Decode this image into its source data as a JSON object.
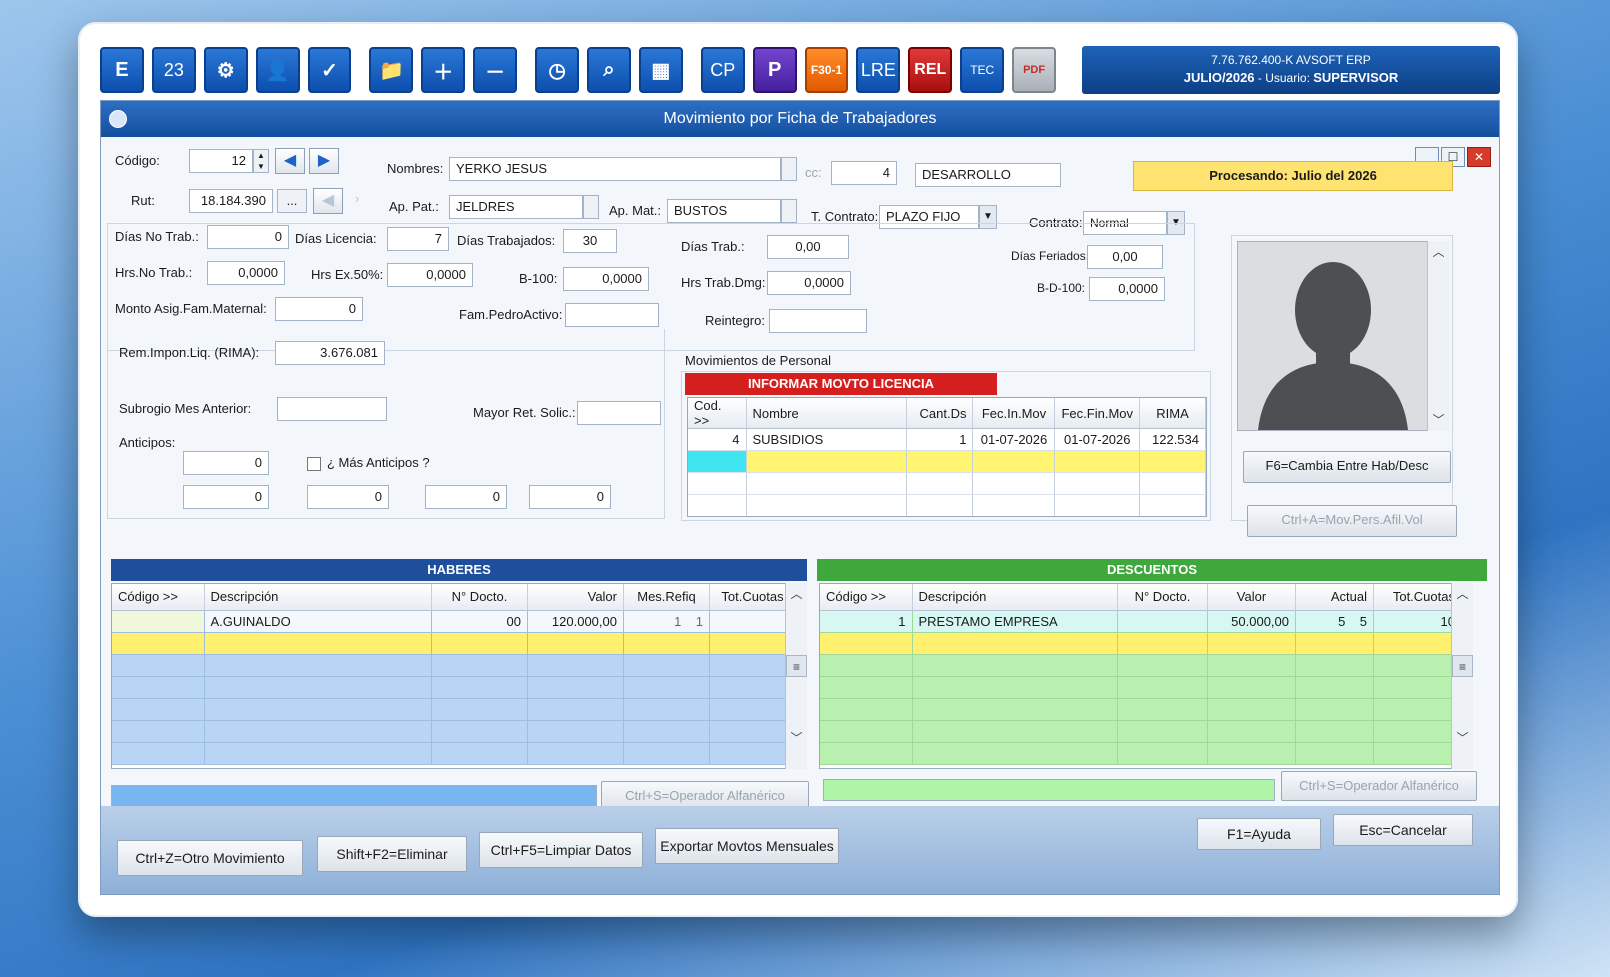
{
  "toolbar": {
    "icons": [
      "E",
      "23",
      "⚙",
      "👤",
      "✓",
      "📁",
      "＋",
      "－",
      "◷",
      "⌕",
      "▦",
      "CP",
      "P",
      "F30-1",
      "LRE",
      "REL",
      "TEC",
      "PDF"
    ]
  },
  "brand": {
    "line1": "7.76.762.400-K AVSOFT ERP",
    "period": "JULIO/2026",
    "user_label": "- Usuario:",
    "user": "SUPERVISOR"
  },
  "window": {
    "title": "Movimiento por Ficha de Trabajadores"
  },
  "form": {
    "codigo_label": "Código:",
    "codigo": "12",
    "rut_label": "Rut:",
    "rut": "18.184.390",
    "rut_btn": "...",
    "nombres_label": "Nombres:",
    "nombres": "YERKO JESUS",
    "cc_label": "cc:",
    "cc_num": "4",
    "cc_name": "DESARROLLO",
    "ap_pat_label": "Ap. Pat.:",
    "ap_pat": "JELDRES",
    "ap_mat_label": "Ap. Mat.:",
    "ap_mat": "BUSTOS",
    "t_contrato_label": "T. Contrato:",
    "t_contrato": "PLAZO FIJO",
    "contrato_label": "Contrato:",
    "contrato": "Normal",
    "procesando": "Procesando: Julio del 2026",
    "dias_no_trab_label": "Días No Trab.:",
    "dias_no_trab": "0",
    "dias_licencia_label": "Días Licencia:",
    "dias_licencia": "7",
    "dias_trabajados_label": "Días Trabajados:",
    "dias_trabajados": "30",
    "dias_trab_label": "Días Trab.:",
    "dias_trab": "0,00",
    "dias_feriados_label": "Días Feriados:",
    "dias_feriados": "0,00",
    "hrs_no_trab_label": "Hrs.No Trab.:",
    "hrs_no_trab": "0,0000",
    "hrs_ex_label": "Hrs Ex.50%:",
    "hrs_ex": "0,0000",
    "b100_label": "B-100:",
    "b100": "0,0000",
    "hrs_trab_dmg_label": "Hrs Trab.Dmg:",
    "hrs_trab_dmg": "0,0000",
    "bd100_label": "B-D-100:",
    "bd100": "0,0000",
    "monto_asig_label": "Monto Asig.Fam.Maternal:",
    "monto_asig": "0",
    "fam_pedro_label": "Fam.PedroActivo:",
    "fam_pedro": "",
    "reintegro_label": "Reintegro:",
    "reintegro": "",
    "rem_impon_label": "Rem.Impon.Liq. (RIMA):",
    "rem_impon": "3.676.081",
    "subrogio_label": "Subrogio Mes Anterior:",
    "subrogio": "",
    "mayor_ret_label": "Mayor Ret. Solic.:",
    "mayor_ret": "",
    "anticipos_label": "Anticipos:",
    "anticipo_main": "0",
    "mas_anticipos_label": "¿ Más Anticipos ?",
    "anticipos_extra": [
      "0",
      "0",
      "0",
      "0"
    ]
  },
  "side_buttons": {
    "f6": "F6=Cambia Entre Hab/Desc",
    "ctrl_a": "Ctrl+A=Mov.Pers.Afil.Vol"
  },
  "movimientos": {
    "label": "Movimientos de Personal",
    "banner": "INFORMAR MOVTO LICENCIA",
    "headers": [
      "Cod. >>",
      "Nombre",
      "Cant.Ds",
      "Fec.In.Mov",
      "Fec.Fin.Mov",
      "RIMA"
    ],
    "rows": [
      [
        "4",
        "SUBSIDIOS",
        "1",
        "01-07-2026",
        "01-07-2026",
        "122.534"
      ]
    ]
  },
  "haberes": {
    "title": "HABERES",
    "headers": [
      "Código >>",
      "Descripción",
      "N° Docto.",
      "Valor",
      "Mes.Refiq",
      "Tot.Cuotas"
    ],
    "row": {
      "codigo": "",
      "descripcion": "A.GUINALDO",
      "docto": "00",
      "valor": "120.000,00",
      "mes_a": "1",
      "mes_b": "1",
      "cuotas": ""
    },
    "operador": "Ctrl+S=Operador Alfanérico"
  },
  "descuentos": {
    "title": "DESCUENTOS",
    "headers": [
      "Código >>",
      "Descripción",
      "N° Docto.",
      "Valor",
      "Actual",
      "Tot.Cuotas"
    ],
    "row": {
      "codigo": "1",
      "descripcion": "PRESTAMO EMPRESA",
      "docto": "",
      "valor": "50.000,00",
      "act_a": "5",
      "act_b": "5",
      "cuotas": "10"
    },
    "operador": "Ctrl+S=Operador Alfanérico"
  },
  "bottom": {
    "otro": "Ctrl+Z=Otro Movimiento",
    "eliminar": "Shift+F2=Eliminar",
    "limpiar": "Ctrl+F5=Limpiar Datos",
    "exportar": "Exportar Movtos Mensuales",
    "ayuda": "F1=Ayuda",
    "cancelar": "Esc=Cancelar"
  },
  "colors": {
    "haberes_header": "#1f4f9c",
    "descuentos_header": "#3ea83c",
    "banner_red": "#d51f1f",
    "highlight_yellow": "#fff070"
  }
}
